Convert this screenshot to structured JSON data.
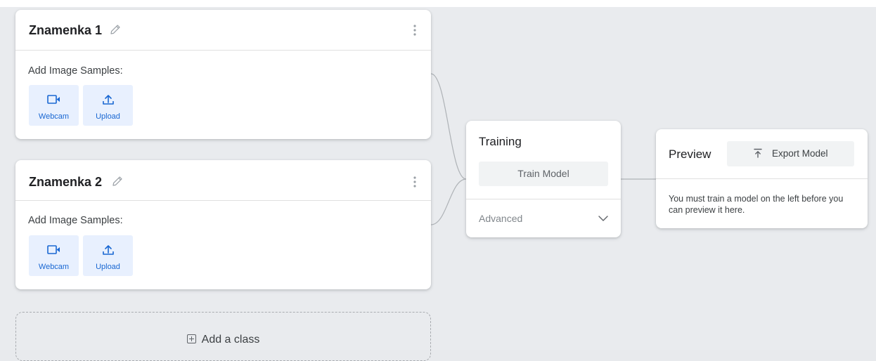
{
  "classes": [
    {
      "name": "Znamenka 1",
      "samples_label": "Add Image Samples:",
      "webcam_label": "Webcam",
      "upload_label": "Upload"
    },
    {
      "name": "Znamenka 2",
      "samples_label": "Add Image Samples:",
      "webcam_label": "Webcam",
      "upload_label": "Upload"
    }
  ],
  "add_class": {
    "label": "Add a class"
  },
  "training": {
    "title": "Training",
    "train_button": "Train Model",
    "advanced_label": "Advanced"
  },
  "preview": {
    "title": "Preview",
    "export_button": "Export Model",
    "message": "You must train a model on the left before you can preview it here."
  },
  "colors": {
    "accent_blue": "#1967d2",
    "sample_button_bg": "#e8f0fe",
    "canvas_bg": "#e9ebee",
    "neutral_button_bg": "#f1f3f4"
  },
  "icons": {
    "edit": "pencil-icon",
    "menu": "kebab-menu-icon",
    "webcam": "video-camera-icon",
    "upload": "upload-arrow-icon",
    "add": "plus-box-icon",
    "advanced": "chevron-down-icon",
    "export": "export-arrow-up-icon"
  }
}
